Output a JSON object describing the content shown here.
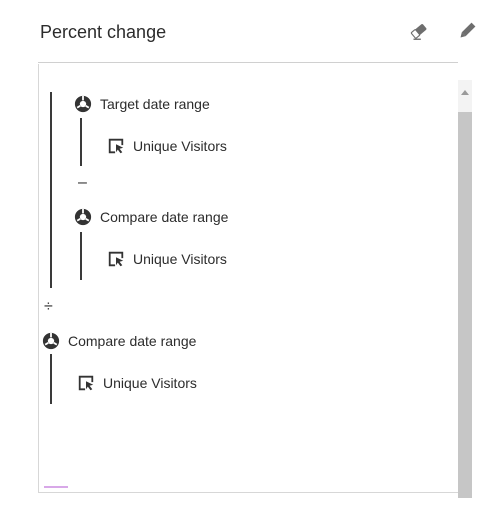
{
  "header": {
    "title": "Percent change",
    "icons": [
      "eraser-icon",
      "pencil-icon"
    ]
  },
  "formula": {
    "numerator": {
      "first": {
        "segment_label": "Target date range",
        "segment_icon": "segment-icon",
        "metric_label": "Unique Visitors",
        "metric_icon": "metric-icon"
      },
      "operator": "–",
      "second": {
        "segment_label": "Compare date range",
        "segment_icon": "segment-icon",
        "metric_label": "Unique Visitors",
        "metric_icon": "metric-icon"
      }
    },
    "operator": "÷",
    "denominator": {
      "segment_label": "Compare date range",
      "segment_icon": "segment-icon",
      "metric_label": "Unique Visitors",
      "metric_icon": "metric-icon"
    }
  },
  "colors": {
    "text": "#2c2c2c",
    "line": "#3a3a3a",
    "scroll_thumb": "#c6c6c6",
    "selection_accent": "#d8a8e8"
  }
}
